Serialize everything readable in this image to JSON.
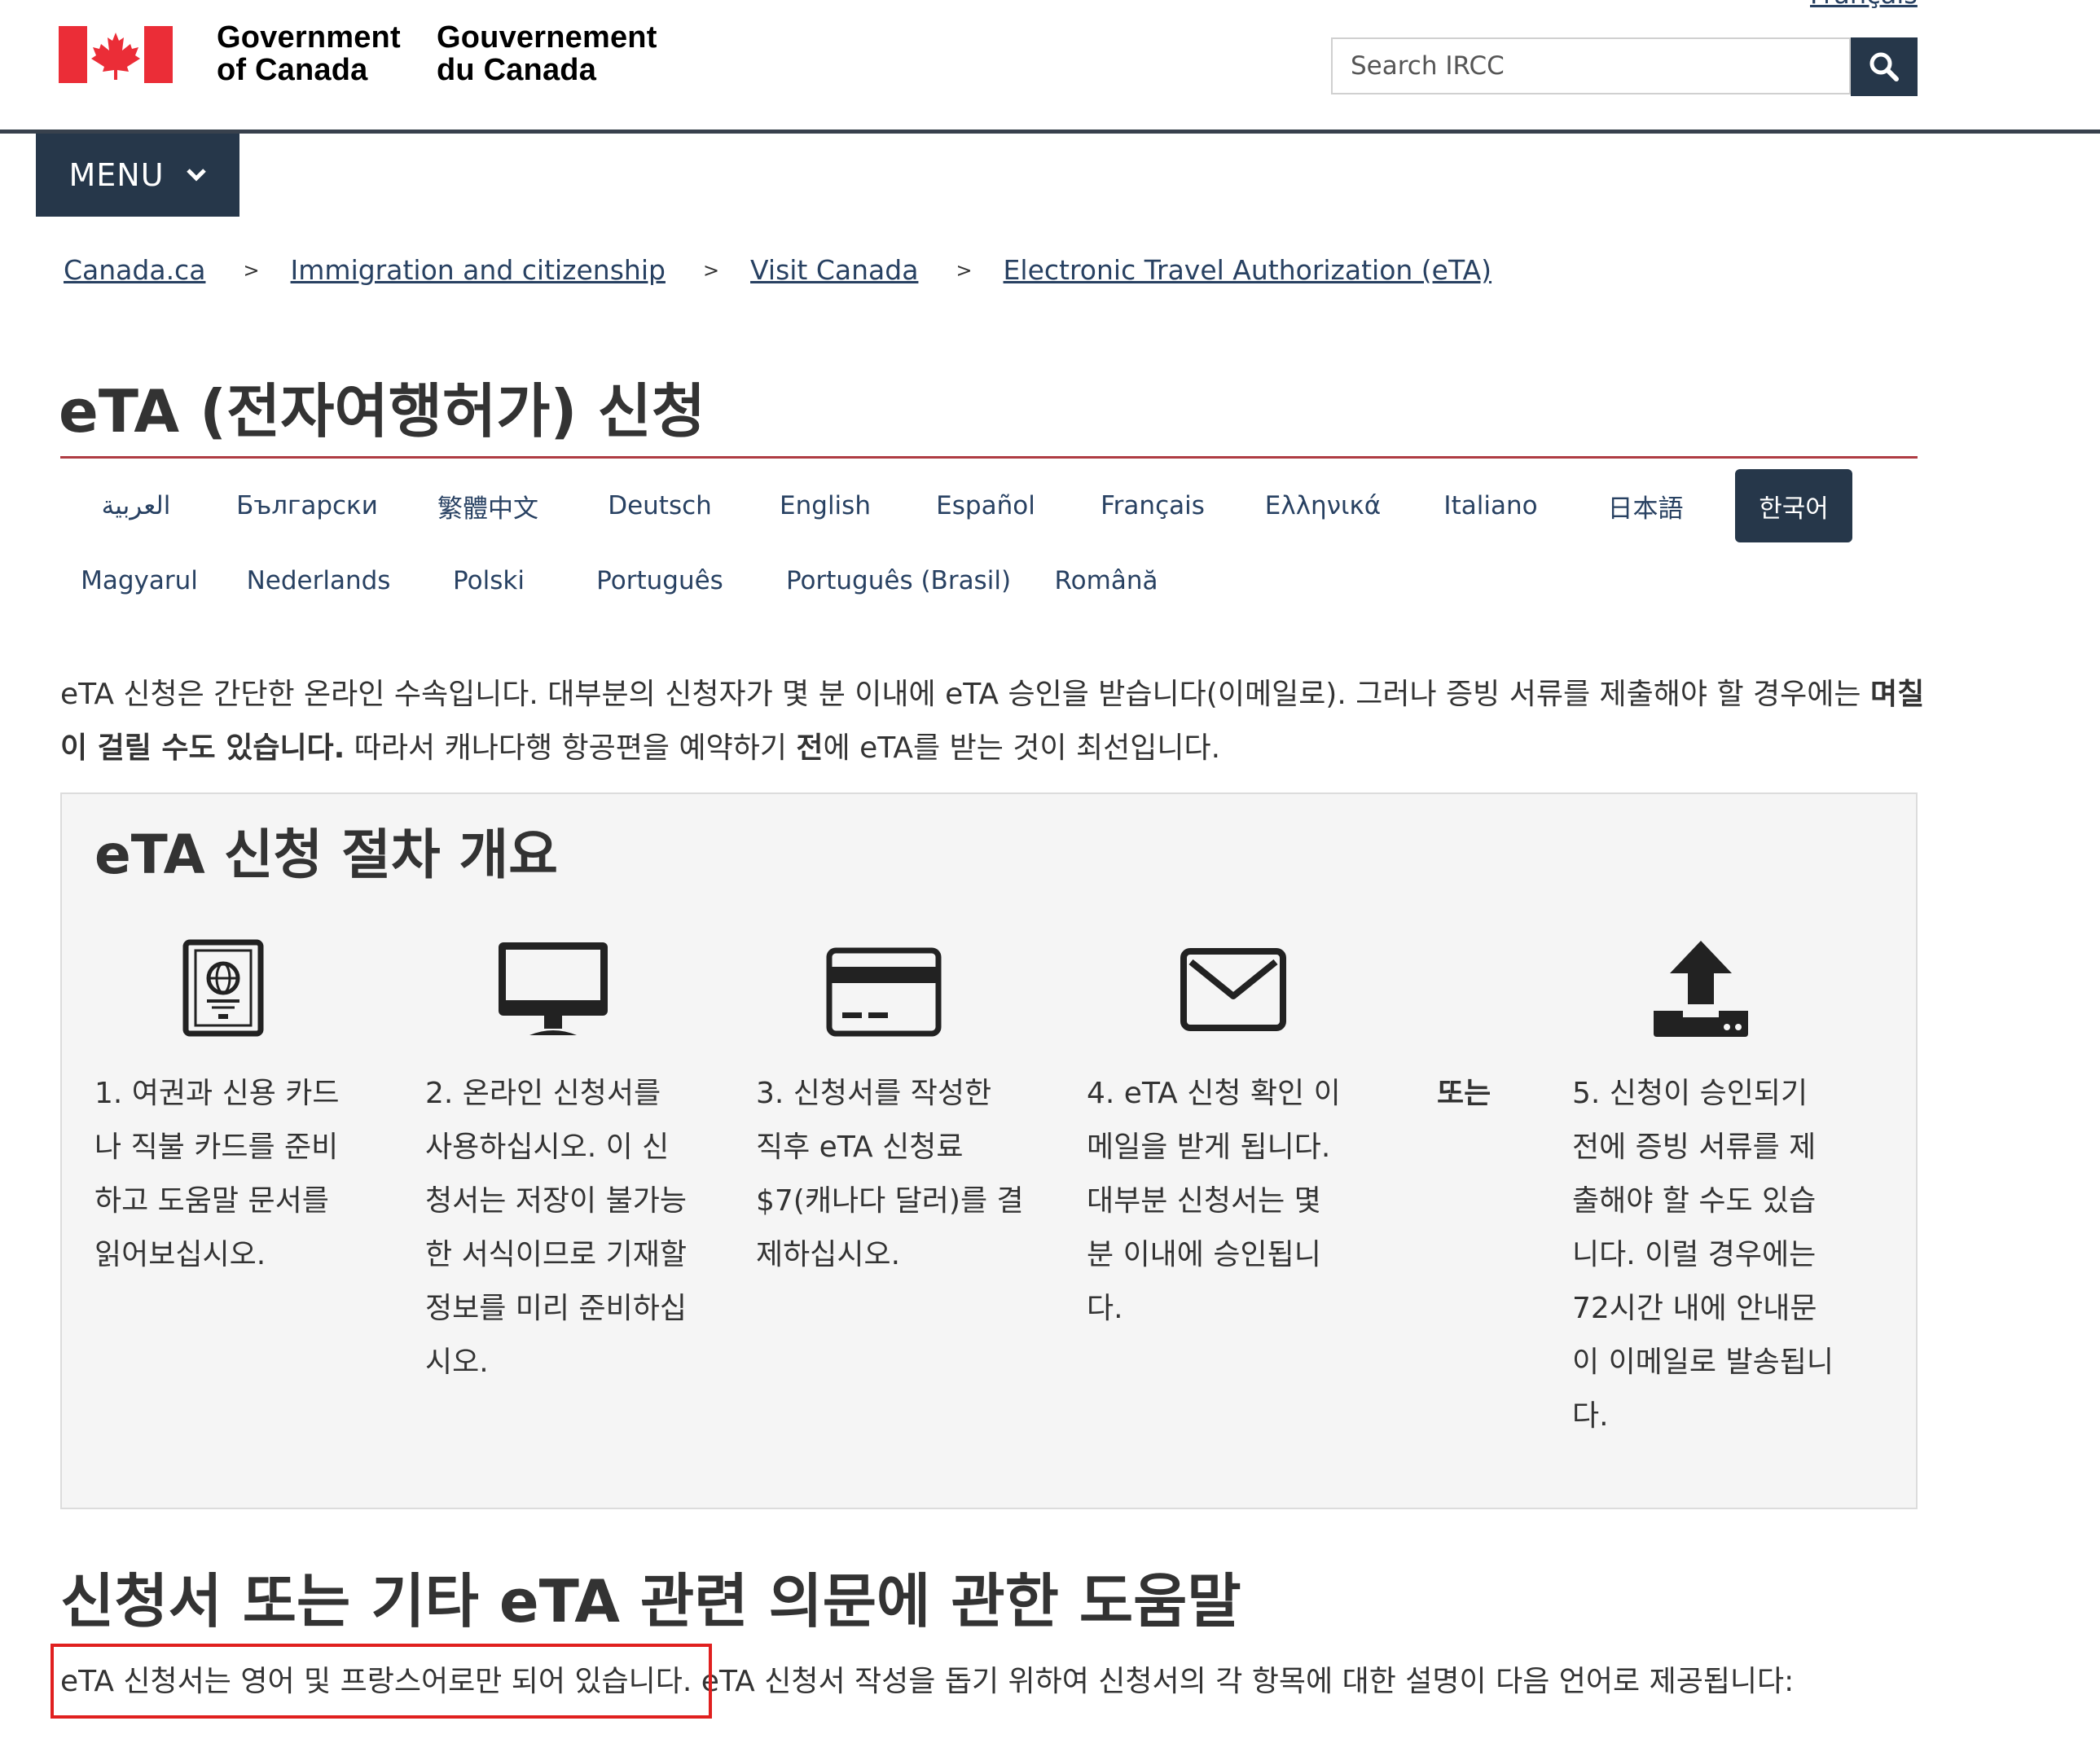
{
  "header": {
    "top_language_link": "Français",
    "signature_en": [
      "Government",
      "of Canada"
    ],
    "signature_fr": [
      "Gouvernement",
      "du Canada"
    ],
    "search_placeholder": "Search IRCC",
    "menu_label": "MENU"
  },
  "breadcrumbs": [
    {
      "label": "Canada.ca"
    },
    {
      "label": "Immigration and citizenship"
    },
    {
      "label": "Visit Canada"
    },
    {
      "label": "Electronic Travel Authorization (eTA)"
    }
  ],
  "page_title": "eTA (전자여행허가) 신청",
  "languages_row1": [
    {
      "label": "العربية"
    },
    {
      "label": "Български"
    },
    {
      "label": "繁體中文"
    },
    {
      "label": "Deutsch"
    },
    {
      "label": "English"
    },
    {
      "label": "Español"
    },
    {
      "label": "Français"
    },
    {
      "label": "Ελληνικά"
    },
    {
      "label": "Italiano"
    },
    {
      "label": "日本語"
    },
    {
      "label": "한국어",
      "active": true
    }
  ],
  "languages_row2": [
    {
      "label": "Magyarul"
    },
    {
      "label": "Nederlands"
    },
    {
      "label": "Polski"
    },
    {
      "label": "Português"
    },
    {
      "label": "Português (Brasil)"
    },
    {
      "label": "Română"
    }
  ],
  "intro": {
    "part1": "eTA 신청은 간단한 온라인 수속입니다. 대부분의 신청자가 몇 분 이내에 eTA 승인을 받습니다(이메일로). 그러나 증빙 서류를 제출해야 할 경우에는 ",
    "bold1": "며칠이 걸릴 수도 있습니다.",
    "part2": " 따라서 캐나다행 항공편을 예약하기 ",
    "bold2": "전",
    "part3": "에 eTA를 받는 것이 최선입니다."
  },
  "overview": {
    "title": "eTA 신청 절차 개요",
    "steps": [
      {
        "icon": "passport-icon",
        "text": "1. 여권과 신용 카드나 직불 카드를 준비하고 도움말 문서를 읽어보십시오."
      },
      {
        "icon": "monitor-icon",
        "text": "2. 온라인 신청서를 사용하십시오. 이 신청서는 저장이 불가능한 서식이므로 기재할 정보를 미리 준비하십시오."
      },
      {
        "icon": "credit-card-icon",
        "text": "3. 신청서를 작성한 직후 eTA 신청료 $7(캐나다 달러)를 결제하십시오."
      },
      {
        "icon": "envelope-icon",
        "text": "4. eTA 신청 확인 이메일을 받게 됩니다. 대부분 신청서는 몇 분 이내에 승인됩니다."
      },
      {
        "icon": "upload-icon",
        "text": "5. 신청이 승인되기 전에 증빙 서류를 제출해야 할 수도 있습니다. 이럴 경우에는 72시간 내에 안내문이 이메일로 발송됩니다."
      }
    ],
    "or_label": "또는"
  },
  "help": {
    "title": "신청서 또는 기타 eTA 관련 의문에 관한 도움말",
    "highlighted_sentence": "eTA 신청서는 영어 및 프랑스어로만 되어 있습니다.",
    "rest_sentence": " eTA 신청서 작성을 돕기 위하여 신청서의 각 항목에 대한 설명이 다음 언어로 제공됩니다:"
  },
  "colors": {
    "accent_dark": "#26374a",
    "link": "#284162",
    "title_rule": "#af3c43",
    "flag_red": "#eb2d37",
    "highlight_red": "#e0201f"
  }
}
